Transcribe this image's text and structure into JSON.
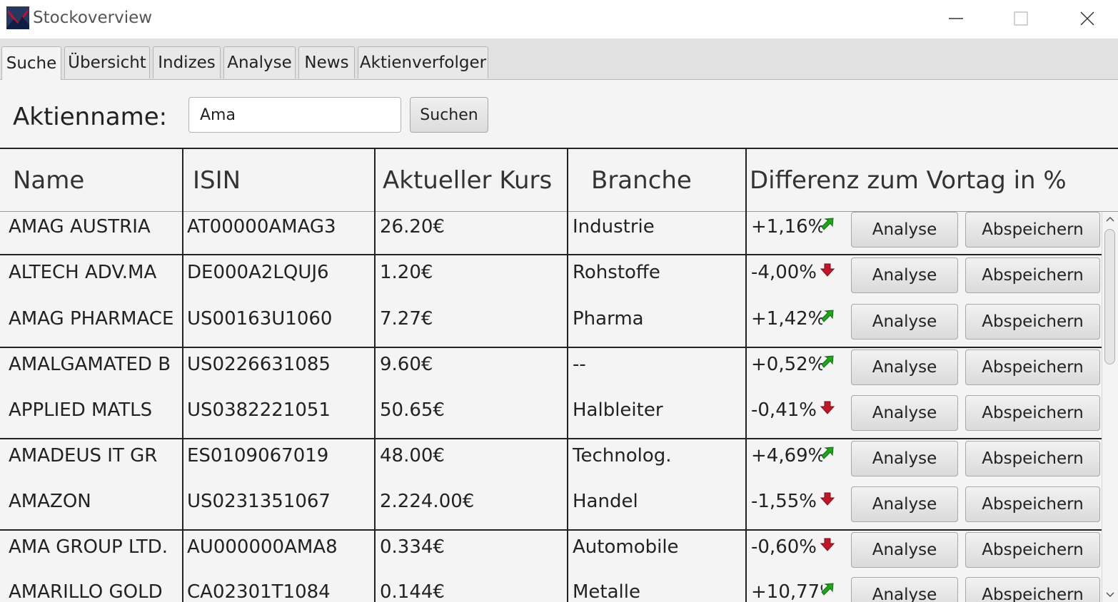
{
  "window": {
    "title": "Stockoverview"
  },
  "tabs": [
    {
      "label": "Suche",
      "active": true
    },
    {
      "label": "Übersicht",
      "active": false
    },
    {
      "label": "Indizes",
      "active": false
    },
    {
      "label": "Analyse",
      "active": false
    },
    {
      "label": "News",
      "active": false
    },
    {
      "label": "Aktienverfolger",
      "active": false
    }
  ],
  "search": {
    "label": "Aktienname:",
    "value": "Ama",
    "button_label": "Suchen"
  },
  "table": {
    "columns": [
      "Name",
      "ISIN",
      "Aktueller Kurs",
      "Branche",
      "Differenz zum Vortag in %"
    ],
    "rows": [
      {
        "name": "AMAG AUSTRIA",
        "isin": "AT00000AMAG3",
        "kurs": "26.20€",
        "branche": "Industrie",
        "diff": "+1,16%",
        "trend": "up"
      },
      {
        "name": "ALTECH ADV.MA",
        "isin": "DE000A2LQUJ6",
        "kurs": "1.20€",
        "branche": "Rohstoffe",
        "diff": "-4,00%",
        "trend": "down"
      },
      {
        "name": "AMAG PHARMACE",
        "isin": "US00163U1060",
        "kurs": "7.27€",
        "branche": "Pharma",
        "diff": "+1,42%",
        "trend": "up"
      },
      {
        "name": "AMALGAMATED B",
        "isin": "US0226631085",
        "kurs": "9.60€",
        "branche": "--",
        "diff": "+0,52%",
        "trend": "up"
      },
      {
        "name": "APPLIED MATLS",
        "isin": "US0382221051",
        "kurs": "50.65€",
        "branche": "Halbleiter",
        "diff": "-0,41%",
        "trend": "down"
      },
      {
        "name": "AMADEUS IT GR",
        "isin": "ES0109067019",
        "kurs": "48.00€",
        "branche": "Technolog.",
        "diff": "+4,69%",
        "trend": "up"
      },
      {
        "name": "AMAZON",
        "isin": "US0231351067",
        "kurs": "2.224.00€",
        "branche": "Handel",
        "diff": "-1,55%",
        "trend": "down"
      },
      {
        "name": "AMA GROUP LTD.",
        "isin": "AU000000AMA8",
        "kurs": "0.334€",
        "branche": "Automobile",
        "diff": "-0,60%",
        "trend": "down"
      },
      {
        "name": "AMARILLO GOLD",
        "isin": "CA02301T1084",
        "kurs": "0.144€",
        "branche": "Metalle",
        "diff": "+10,77%",
        "trend": "up"
      }
    ],
    "analyse_label": "Analyse",
    "save_label": "Abspeichern"
  },
  "colors": {
    "up_arrow": "#1fa51f",
    "down_arrow": "#c0182a",
    "grid_line": "#222222"
  }
}
